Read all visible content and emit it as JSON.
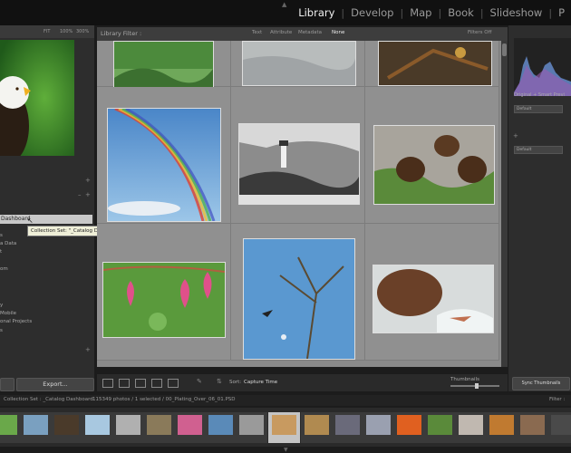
{
  "modules": [
    "Library",
    "Develop",
    "Map",
    "Book",
    "Slideshow",
    "P"
  ],
  "active_module": "Library",
  "navigator": {
    "zoom_levels": [
      "FIT",
      "100%",
      "300%"
    ]
  },
  "left_panel": {
    "rows": [
      "Dashboard",
      "s",
      "a Data",
      "t",
      "om",
      "y",
      "Mobile",
      "onal Projects",
      "s"
    ],
    "selected_row": "Dashboard",
    "export_button": "Export..."
  },
  "tooltip": "Collection Set: \"_Catalog Dashboard\"",
  "filter_bar": {
    "title": "Library Filter :",
    "tabs": [
      "Text",
      "Attribute",
      "Metadata",
      "None"
    ],
    "active_tab": "None",
    "filters_off": "Filters Off"
  },
  "toolbar": {
    "sort_label": "Sort:",
    "sort_value": "Capture Time",
    "thumbnails_label": "Thumbnails"
  },
  "right_panel": {
    "histogram_label": "Original + Smart Previ",
    "preset_default_1": "Default",
    "preset_default_2": "Default",
    "sync_button": "Sync Thumbnails"
  },
  "info_bar": {
    "collection": "Collection Set : _Catalog Dashboard",
    "counts": "115349 photos / 1 selected / 00_Plating_Over_06_01.PSD",
    "filter_label": "Filter :"
  },
  "colors": {
    "accent": "#f0f0f0",
    "panel": "#2d2d2d",
    "grid": "#8a8a8a"
  }
}
